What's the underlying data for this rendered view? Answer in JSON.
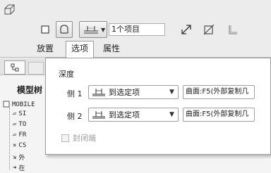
{
  "dashboard": {
    "feature_icon": "extrude-feature-icon",
    "buttons": {
      "solid": "solid-icon",
      "surface": "surface-icon",
      "depth": "depth-option-icon",
      "flip": "flip-direction-icon",
      "remove_material": "remove-material-icon",
      "thicken": "thicken-icon"
    },
    "collector_value": "1个项目"
  },
  "tabs": [
    {
      "label": "放置"
    },
    {
      "label": "选项"
    },
    {
      "label": "属性"
    }
  ],
  "navigator": {
    "title": "模型树",
    "root": "MOBILE",
    "items": [
      "SI",
      "TO",
      "FR",
      "CS",
      "外",
      "在"
    ]
  },
  "options_panel": {
    "depth_label": "深度",
    "side1": {
      "label": "侧 1",
      "depth_value": "到选定项",
      "reference": "曲面:F5(外部复制几"
    },
    "side2": {
      "label": "侧 2",
      "depth_value": "到选定项",
      "reference": "曲面:F5(外部复制几"
    },
    "capped_ends": {
      "label": "封闭端",
      "checked": false,
      "enabled": false
    }
  }
}
